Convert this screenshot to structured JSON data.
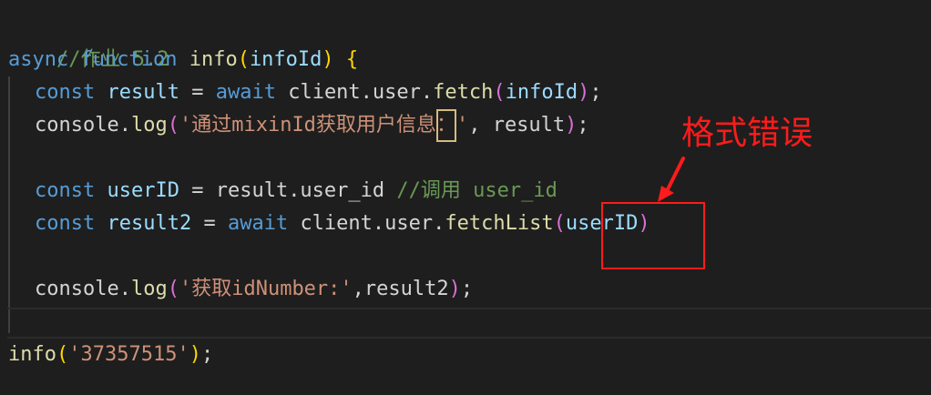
{
  "code": {
    "line1_comment": "//作业 5.2",
    "line2": {
      "kw_async": "async",
      "kw_function": "function",
      "fn_name": "info",
      "paren_open": "(",
      "param": "infoId",
      "paren_close": ")",
      "brace": "{"
    },
    "line3": {
      "kw_const": "const",
      "var": "result",
      "op": "=",
      "kw_await": "await",
      "obj": "client.user.",
      "method": "fetch",
      "paren_open": "(",
      "arg": "infoId",
      "paren_close": ")",
      "end": ";"
    },
    "line4": {
      "obj": "console.",
      "method": "log",
      "paren_open": "(",
      "str_start": "'通过mixinId获取用户信息",
      "str_hl": "：",
      "str_end": "'",
      "rest": ", result",
      "paren_close": ")",
      "end": ";"
    },
    "line6": {
      "kw_const": "const",
      "var": "userID",
      "op": "=",
      "expr": "result.user_id",
      "comment": "//调用 user_id"
    },
    "line7": {
      "kw_const": "const",
      "var": "result2",
      "op": "=",
      "kw_await": "await",
      "obj": "client.user.",
      "method": "fetchList",
      "paren_open": "(",
      "arg": "userID",
      "paren_close": ")"
    },
    "line9": {
      "obj": "console.",
      "method": "log",
      "paren_open": "(",
      "str": "'获取idNumber:'",
      "rest": ",result2",
      "paren_close": ")",
      "end": ";"
    },
    "line12": {
      "method": "info",
      "paren_open": "(",
      "str": "'37357515'",
      "paren_close": ")",
      "end": ";"
    }
  },
  "annotation": {
    "label": "格式错误",
    "color": "#ff1b1b"
  },
  "colors": {
    "background": "#1e1e1e",
    "comment": "#6a9955",
    "keyword": "#569cd6",
    "function": "#dcdcaa",
    "variable": "#9cdcfe",
    "string": "#ce9178",
    "bracket_gold": "#ffd700",
    "bracket_purple": "#da70d6"
  }
}
